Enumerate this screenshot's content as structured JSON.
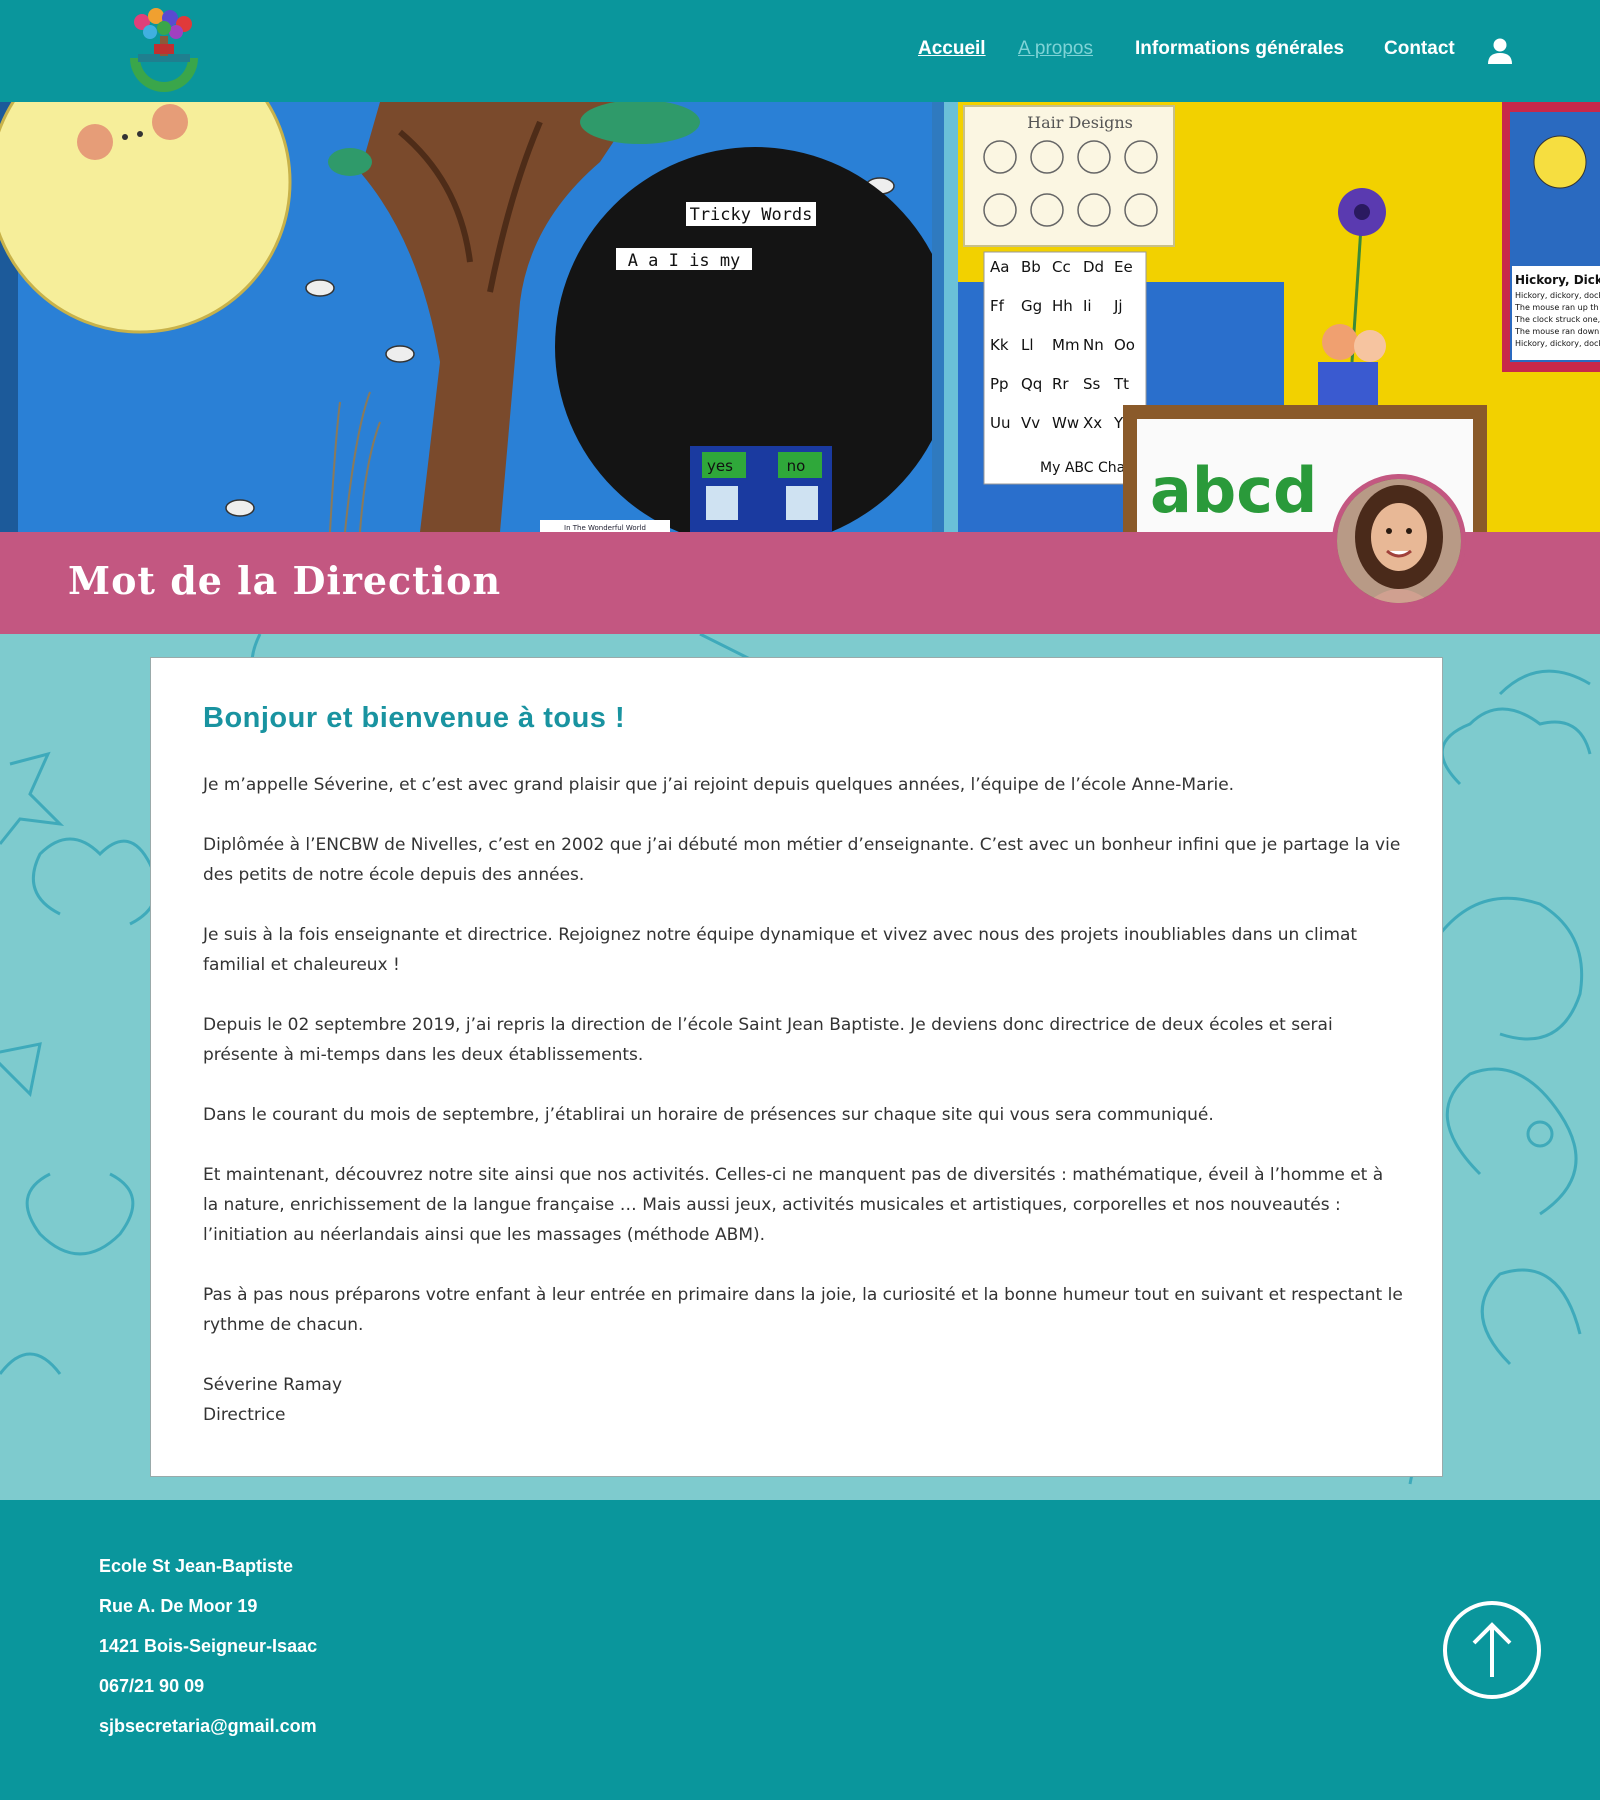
{
  "header": {
    "logo_icon": "school-logo",
    "nav": {
      "accueil": "Accueil",
      "apropos": "A propos",
      "infos": "Informations générales",
      "contact": "Contact"
    },
    "user_icon": "user-icon"
  },
  "hero": {
    "sign_tricky_words": "Tricky Words",
    "sign_letters": "A a I is my",
    "poster_hair_designs": "Hair Designs",
    "yes_label": "yes",
    "no_label": "no",
    "abc_chart_label": "My ABC Cha",
    "alphabet_pairs": [
      "Aa",
      "Bb",
      "Cc",
      "Dd",
      "Ee",
      "Ff",
      "Gg",
      "Hh",
      "Ii",
      "Jj",
      "Kk",
      "Ll",
      "Mm",
      "Nn",
      "Oo",
      "Pp",
      "Qq",
      "Rr",
      "Ss",
      "Tt",
      "Uu",
      "Vv",
      "Ww",
      "Xx",
      "Y"
    ],
    "hickory_title": "Hickory, Dickory,",
    "hickory_lines": [
      "Hickory, dickory, dock",
      "The mouse ran up th",
      "The clock struck one,",
      "The mouse ran down",
      "Hickory, dickory, dock"
    ],
    "book_title": "In The Wonderful World",
    "magnet_letters": "abcd"
  },
  "title_band": {
    "title": "Mot de la Direction"
  },
  "content": {
    "heading": "Bonjour et bienvenue à tous !",
    "paragraphs": [
      "Je m’appelle Séverine, et c’est avec grand plaisir que j’ai rejoint depuis quelques années, l’équipe de l’école Anne-Marie.",
      "Diplômée à l’ENCBW de Nivelles, c’est en 2002 que j’ai débuté mon métier d’enseignante. C’est avec un bonheur infini que je partage la vie des petits de notre école depuis des années.",
      "Je suis à la fois enseignante et directrice. Rejoignez notre équipe dynamique et vivez avec nous des projets inoubliables dans un climat familial et chaleureux !",
      "Depuis le 02 septembre 2019, j’ai repris la direction de l’école Saint Jean Baptiste. Je deviens donc directrice de deux écoles et serai présente à mi-temps dans les deux établissements.",
      "Dans le courant du mois de septembre, j’établirai un horaire de présences sur chaque site qui vous sera communiqué.",
      "Et maintenant, découvrez notre site ainsi que nos activités. Celles-ci ne manquent pas de diversités : mathématique, éveil à l’homme et à la nature, enrichissement de la langue française … Mais aussi jeux, activités musicales et artistiques, corporelles et nos nouveautés : l’initiation au néerlandais ainsi que les massages (méthode ABM).",
      "Pas à pas nous préparons votre enfant à leur entrée en primaire dans la joie, la curiosité et la bonne humeur tout en suivant et respectant le rythme de chacun."
    ],
    "signature_name": "Séverine Ramay",
    "signature_role": "Directrice"
  },
  "footer": {
    "school": "Ecole St Jean-Baptiste",
    "street": "Rue A. De Moor 19",
    "city": "1421 Bois-Seigneur-Isaac",
    "phone": "067/21 90 09",
    "email": "sjbsecretaria@gmail.com",
    "scroll_icon": "arrow-up-icon"
  },
  "colors": {
    "teal": "#0a969c",
    "light_teal": "#7ecbce",
    "pink": "#c35781",
    "heading_teal": "#1993a0"
  }
}
